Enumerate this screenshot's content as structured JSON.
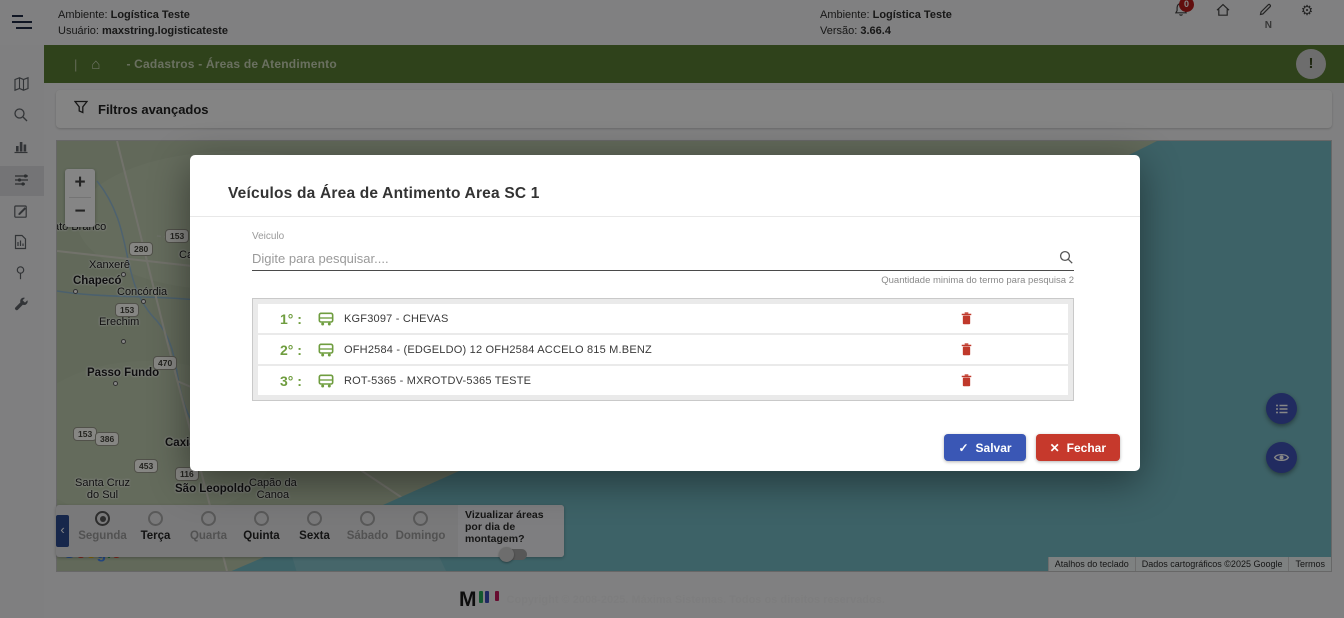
{
  "header": {
    "left": {
      "env_label": "Ambiente:",
      "env_value": "Logística Teste",
      "user_label": "Usuário:",
      "user_value": "maxstring.logisticateste"
    },
    "right": {
      "env_label": "Ambiente:",
      "env_value": "Logística Teste",
      "version_label": "Versão:",
      "version_value": "3.66.4"
    },
    "icons": [
      "bell-icon",
      "home-icon",
      "pencil-icon",
      "gear-icon"
    ],
    "notification_count": "0",
    "shortcut_hint": "N",
    "gear_glyph": "⚙"
  },
  "breadcrumb": {
    "separator": "|",
    "home_glyph": "⌂",
    "path": "- Cadastros - Áreas de Atendimento",
    "alert_glyph": "!"
  },
  "sidebar": {
    "icons": [
      "map-icon",
      "search-icon",
      "chart-icon",
      "filter-list-icon",
      "edit-icon",
      "report-icon",
      "pin-icon",
      "tools-icon"
    ],
    "active_index": 3
  },
  "filters": {
    "label": "Filtros avançados"
  },
  "map": {
    "zoom_in": "+",
    "zoom_out": "−",
    "cities": [
      {
        "name": "ato Branco"
      },
      {
        "name": "Xanxerê"
      },
      {
        "name": "Chapecó",
        "bold": true
      },
      {
        "name": "Concórdia"
      },
      {
        "name": "Caçador"
      },
      {
        "name": "Erechim"
      },
      {
        "name": "Passo Fundo",
        "bold": true
      },
      {
        "name": "Caxias do",
        "bold": true
      },
      {
        "name": "Santa Cruz\ndo Sul"
      },
      {
        "name": "São Leopoldo",
        "bold": true
      },
      {
        "name": "Capão da\nCanoa"
      }
    ],
    "shields": [
      "153",
      "280",
      "153",
      "470",
      "153",
      "386",
      "453",
      "116"
    ],
    "google_logo": "Google",
    "attribution": [
      "Atalhos do teclado",
      "Dados cartográficos ©2025 Google",
      "Termos"
    ]
  },
  "floating_buttons": [
    "list-icon",
    "eye-icon"
  ],
  "day_bar": {
    "days": [
      {
        "label": "Segunda",
        "selected": true
      },
      {
        "label": "Terça",
        "emphasis": true
      },
      {
        "label": "Quarta"
      },
      {
        "label": "Quinta",
        "emphasis": true
      },
      {
        "label": "Sexta",
        "emphasis": true
      },
      {
        "label": "Sábado"
      },
      {
        "label": "Domingo"
      }
    ],
    "toggle_label": "Vizualizar áreas por dia de montagem?",
    "toggle_state": "off",
    "collapse_glyph": "‹"
  },
  "modal": {
    "title": "Veículos da Área de Antimento Area SC 1",
    "field_label": "Veiculo",
    "search_placeholder": "Digite para pesquisar....",
    "search_hint": "Quantidade minima do termo para pesquisa 2",
    "vehicles": [
      {
        "order": "1° :",
        "label": "KGF3097 - CHEVAS"
      },
      {
        "order": "2° :",
        "label": "OFH2584 - (EDGELDO) 12 OFH2584 ACCELO 815 M.BENZ"
      },
      {
        "order": "3° :",
        "label": "ROT-5365 - MXROTDV-5365 TESTE"
      }
    ],
    "buttons": {
      "save_glyph": "✓",
      "save": "Salvar",
      "close_glyph": "✕",
      "close": "Fechar"
    }
  },
  "footer": {
    "logo_letter": "M",
    "copyright": "Copyright © 2008-2025. Máxima Sistemas. Todos os direitos reservados."
  },
  "colors": {
    "brand_green": "#5a7d33",
    "ordinal_green": "#6f9d3f",
    "save_blue": "#3a57b5",
    "close_red": "#c6392c",
    "floating_blue": "#3f51b5",
    "danger_red": "#c0392b",
    "badge_red": "#b71c1c"
  }
}
